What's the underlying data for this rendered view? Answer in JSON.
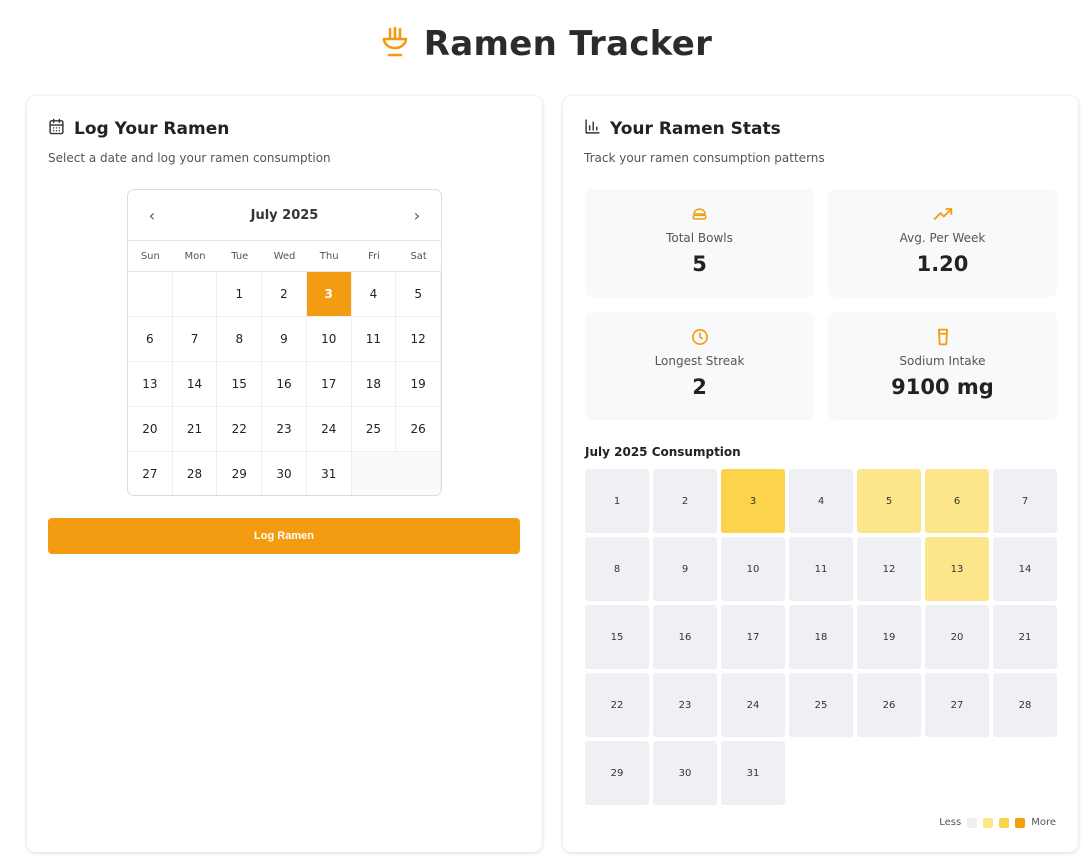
{
  "app": {
    "title": "Ramen Tracker",
    "icon": "ramen-bowl-icon",
    "accent_color": "#f39c12"
  },
  "log_card": {
    "icon": "calendar-icon",
    "title": "Log Your Ramen",
    "subtitle": "Select a date and log your ramen consumption",
    "calendar": {
      "month_label": "July 2025",
      "prev_label": "‹",
      "next_label": "›",
      "weekdays": [
        "Sun",
        "Mon",
        "Tue",
        "Wed",
        "Thu",
        "Fri",
        "Sat"
      ],
      "leading_blank_days": 2,
      "days_in_month": 31,
      "selected_day": 3
    },
    "log_button_label": "Log Ramen"
  },
  "stats_card": {
    "icon": "bar-chart-icon",
    "title": "Your Ramen Stats",
    "subtitle": "Track your ramen consumption patterns",
    "stats": [
      {
        "icon": "bowl-icon",
        "label": "Total Bowls",
        "value": "5"
      },
      {
        "icon": "trending-up-icon",
        "label": "Avg. Per Week",
        "value": "1.20"
      },
      {
        "icon": "clock-icon",
        "label": "Longest Streak",
        "value": "2"
      },
      {
        "icon": "cup-icon",
        "label": "Sodium Intake",
        "value": "9100 mg"
      }
    ],
    "consumption_title": "July 2025 Consumption",
    "heatmap": {
      "days_in_month": 31,
      "levels": {
        "3": 2,
        "5": 1,
        "6": 1,
        "13": 1
      }
    },
    "legend": {
      "less_label": "Less",
      "more_label": "More",
      "colors": [
        "#eef0f4",
        "#fde68a",
        "#fcd34d",
        "#f59e0b"
      ]
    }
  }
}
